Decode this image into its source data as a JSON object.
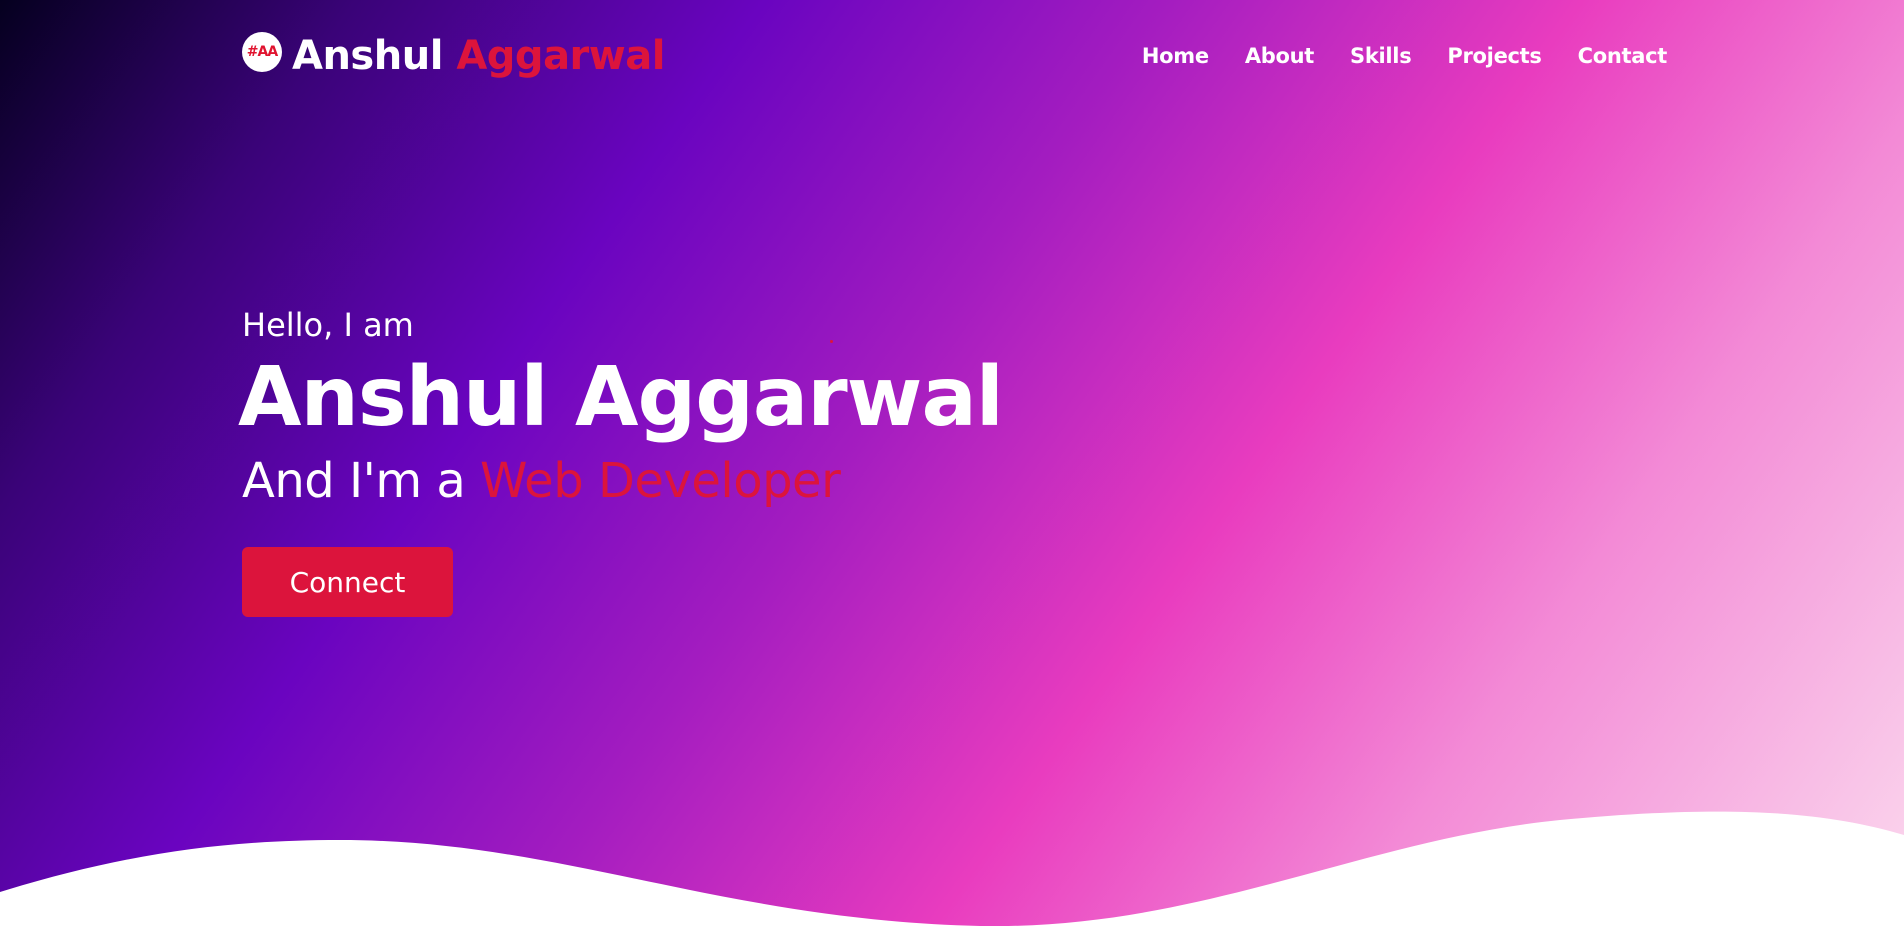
{
  "nav": {
    "logo_badge": "#AA",
    "logo_first": "Anshul",
    "logo_last": "Aggarwal",
    "links": [
      "Home",
      "About",
      "Skills",
      "Projects",
      "Contact"
    ]
  },
  "hero": {
    "greeting": "Hello, I am",
    "name": "Anshul Aggarwal",
    "role_prefix": "And I'm a",
    "role_highlight": "Web Developer",
    "cta_label": "Connect"
  },
  "colors": {
    "accent": "#dc143c",
    "gradient_start": "#05001f",
    "gradient_mid": "#6a04c0",
    "gradient_pink": "#e93cbf",
    "text": "#ffffff"
  }
}
